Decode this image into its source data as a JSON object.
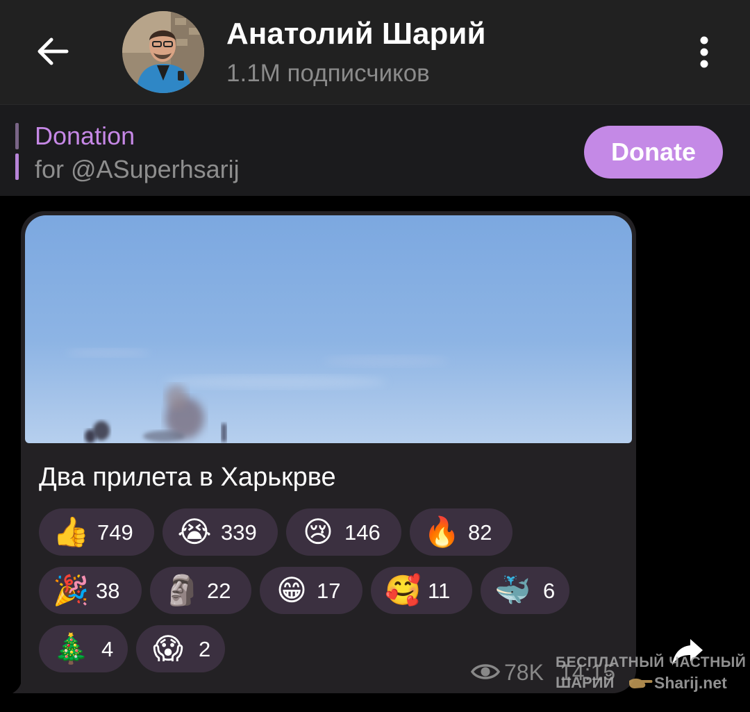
{
  "header": {
    "title": "Анатолий Шарий",
    "subtitle": "1.1M подписчиков"
  },
  "pinned": {
    "title": "Donation",
    "subtitle": "for @ASuperhsarij",
    "button_label": "Donate"
  },
  "post": {
    "caption": "Два прилета в Харькрве",
    "views": "78K",
    "time": "14:15",
    "reactions": [
      {
        "emoji": "👍",
        "icon": "thumbs-up-icon",
        "count": "749"
      },
      {
        "emoji": "😭",
        "icon": "loudly-crying-icon",
        "count": "339"
      },
      {
        "emoji": "😢",
        "icon": "crying-face-icon",
        "count": "146"
      },
      {
        "emoji": "🔥",
        "icon": "fire-icon",
        "count": "82"
      },
      {
        "emoji": "🎉",
        "icon": "party-popper-icon",
        "count": "38"
      },
      {
        "emoji": "🗿",
        "icon": "moai-icon",
        "count": "22"
      },
      {
        "emoji": "😁",
        "icon": "grinning-face-icon",
        "count": "17"
      },
      {
        "emoji": "🥰",
        "icon": "smiling-hearts-icon",
        "count": "11"
      },
      {
        "emoji": "🐳",
        "icon": "whale-icon",
        "count": "6"
      },
      {
        "emoji": "🎄",
        "icon": "christmas-tree-icon",
        "count": "4"
      },
      {
        "emoji": "😱",
        "icon": "screaming-face-icon",
        "count": "2"
      }
    ]
  },
  "watermark": {
    "line1": "БЕСПЛАТНЫЙ ЧАСТНЫЙ",
    "line2a": "ШАРИЙ",
    "line2b": "Sharij.net"
  },
  "colors": {
    "accent": "#c489e6",
    "header_bg": "#212121",
    "bubble_bg": "#232124",
    "chip_bg": "#3b3040",
    "sky": "#86aee0"
  }
}
